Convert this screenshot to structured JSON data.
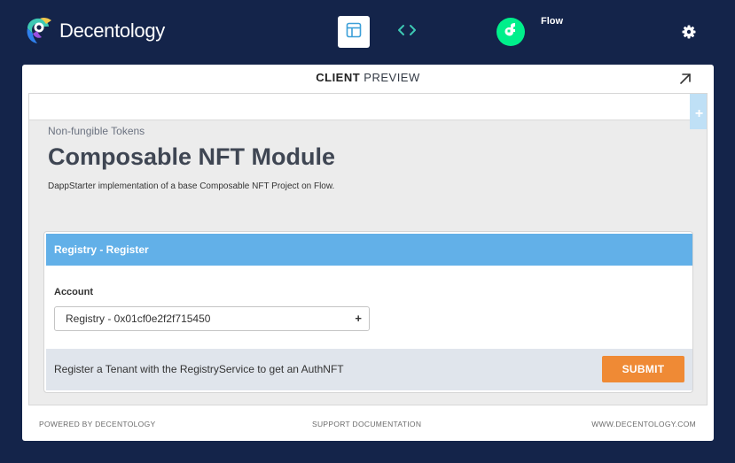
{
  "header": {
    "brand": "Decentology",
    "network_label": "Flow",
    "icons": {
      "logo": "parrot-logo-icon",
      "layout": "layout-icon",
      "code": "code-icon",
      "network": "flow-icon",
      "settings": "gear-icon"
    },
    "colors": {
      "background": "#14244a",
      "accent": "#3dc9b4",
      "flow": "#00ef8b"
    }
  },
  "panel": {
    "title_bold": "CLIENT",
    "title_rest": " PREVIEW",
    "expand_icon": "expand-arrow-icon",
    "add_tab_label": "+"
  },
  "module": {
    "breadcrumb": "Non-fungible Tokens",
    "title": "Composable NFT Module",
    "description": "DappStarter implementation of a base Composable NFT Project on Flow."
  },
  "card": {
    "header": "Registry - Register",
    "account_label": "Account",
    "account_value": "Registry - 0x01cf0e2f2f715450",
    "account_add": "+",
    "footer_text": "Register a Tenant with the RegistryService to get an AuthNFT",
    "submit_label": "SUBMIT",
    "colors": {
      "header": "#62b0e8",
      "submit": "#ef8a35"
    }
  },
  "footer": {
    "left": "POWERED BY DECENTOLOGY",
    "middle": "SUPPORT DOCUMENTATION",
    "right": "WWW.DECENTOLOGY.COM"
  }
}
